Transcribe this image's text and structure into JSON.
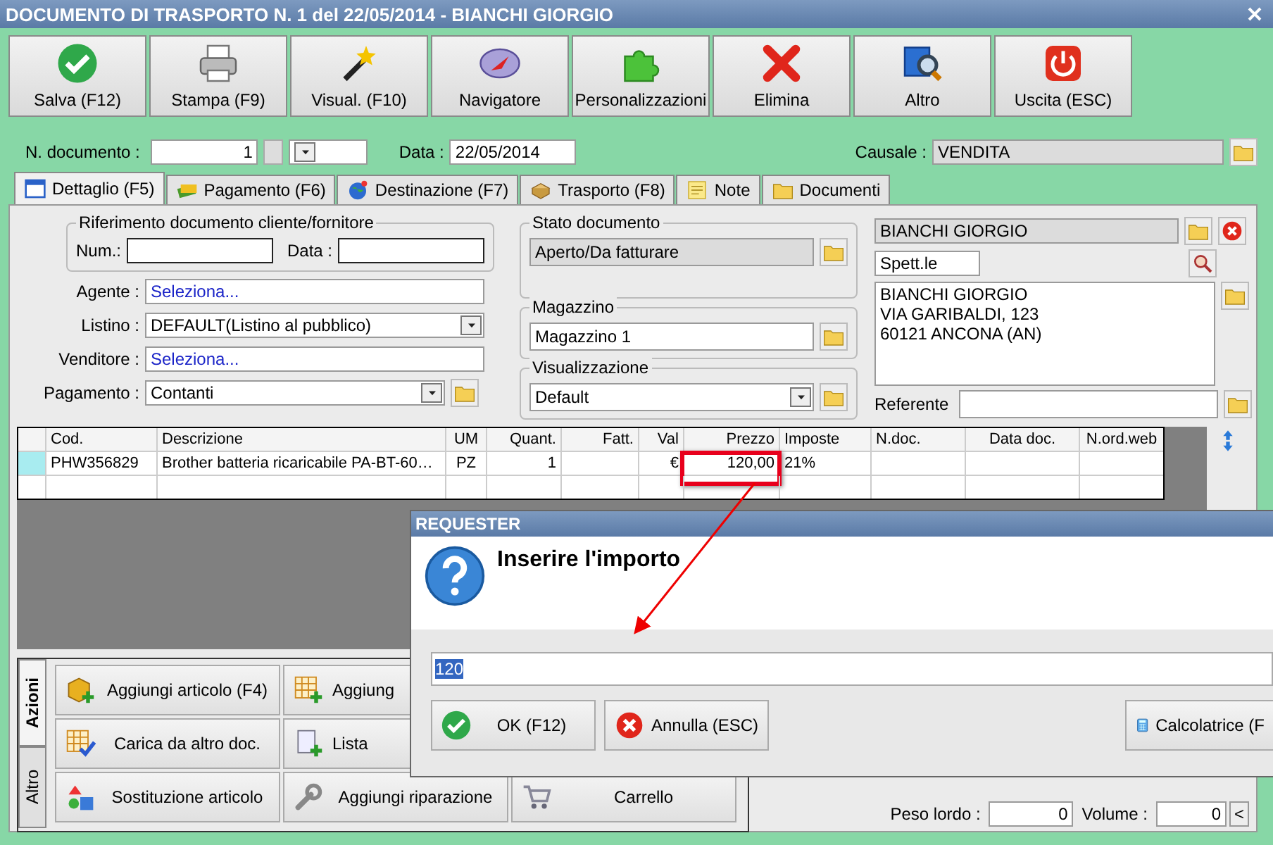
{
  "window": {
    "title": "DOCUMENTO DI TRASPORTO N. 1 del 22/05/2014 - BIANCHI GIORGIO"
  },
  "toolbar": [
    "Salva (F12)",
    "Stampa (F9)",
    "Visual. (F10)",
    "Navigatore",
    "Personalizzazioni",
    "Elimina",
    "Altro",
    "Uscita (ESC)"
  ],
  "header": {
    "number_label": "N. documento :",
    "number": "1",
    "date_label": "Data :",
    "date": "22/05/2014",
    "causale_label": "Causale :",
    "causale": "VENDITA"
  },
  "tabs": [
    {
      "label": "Dettaglio (F5)",
      "selected": true
    },
    {
      "label": "Pagamento (F6)",
      "selected": false
    },
    {
      "label": "Destinazione (F7)",
      "selected": false
    },
    {
      "label": "Trasporto (F8)",
      "selected": false
    },
    {
      "label": "Note",
      "selected": false
    },
    {
      "label": "Documenti",
      "selected": false
    }
  ],
  "reference": {
    "title": "Riferimento documento cliente/fornitore",
    "num_label": "Num.:",
    "date_label": "Data :"
  },
  "fields": [
    {
      "label": "Agente :",
      "value": "Seleziona...",
      "kind": "link"
    },
    {
      "label": "Listino :",
      "value": "DEFAULT(Listino al pubblico)",
      "kind": "select"
    },
    {
      "label": "Venditore :",
      "value": "Seleziona...",
      "kind": "link"
    },
    {
      "label": "Pagamento :",
      "value": "Contanti",
      "kind": "select_folder"
    }
  ],
  "status": {
    "title": "Stato documento",
    "value": "Aperto/Da fatturare"
  },
  "warehouse": {
    "title": "Magazzino",
    "value": "Magazzino 1"
  },
  "view": {
    "title": "Visualizzazione",
    "value": "Default"
  },
  "customer": {
    "name": "BIANCHI GIORGIO",
    "salutation": "Spett.le",
    "address": [
      "BIANCHI GIORGIO",
      "VIA GARIBALDI, 123",
      "60121 ANCONA (AN)"
    ],
    "contact_label": "Referente"
  },
  "table": {
    "columns": [
      "Cod.",
      "Descrizione",
      "UM",
      "Quant.",
      "Fatt.",
      "Val",
      "Prezzo",
      "Imposte",
      "N.doc.",
      "Data doc.",
      "N.ord.web"
    ],
    "rows": [
      [
        "PHW356829",
        "Brother batteria ricaricabile PA-BT-60…",
        "PZ",
        "1",
        null,
        "€",
        "120,00",
        "21%",
        null,
        null,
        null
      ]
    ]
  },
  "actions": {
    "side_tabs": [
      {
        "label": "Azioni",
        "selected": true
      },
      {
        "label": "Altro",
        "selected": false
      }
    ],
    "buttons": [
      "Aggiungi articolo (F4)",
      "Aggiung",
      "Carica da altro doc.",
      "Lista",
      "Sostituzione articolo",
      "Aggiungi riparazione",
      "Carrello"
    ]
  },
  "footer": {
    "weight_label": "Peso lordo :",
    "weight": "0",
    "volume_label": "Volume :",
    "volume": "0",
    "button": "<"
  },
  "dialog": {
    "title": "REQUESTER",
    "heading": "Inserire l'importo",
    "value": "120",
    "buttons": [
      "OK (F12)",
      "Annulla (ESC)",
      "Calcolatrice (F"
    ]
  }
}
